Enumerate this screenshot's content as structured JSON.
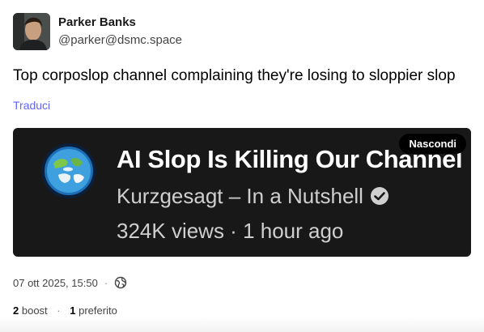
{
  "author": {
    "display_name": "Parker Banks",
    "handle": "@parker@dsmc.space"
  },
  "status": {
    "text": "Top corposlop channel complaining they're losing to sloppier slop",
    "translate_label": "Traduci"
  },
  "media": {
    "video_title": "AI Slop Is Killing Our Channel",
    "channel": "Kurzgesagt – In a Nutshell",
    "meta": "324K views · 1 hour ago",
    "hide_label": "Nascondi"
  },
  "footer": {
    "timestamp": "07 ott 2025, 15:50",
    "separator": "·",
    "visibility_icon": "globe-icon",
    "boost_count": "2",
    "boost_label": "boost",
    "favorite_count": "1",
    "favorite_label": "preferito"
  }
}
